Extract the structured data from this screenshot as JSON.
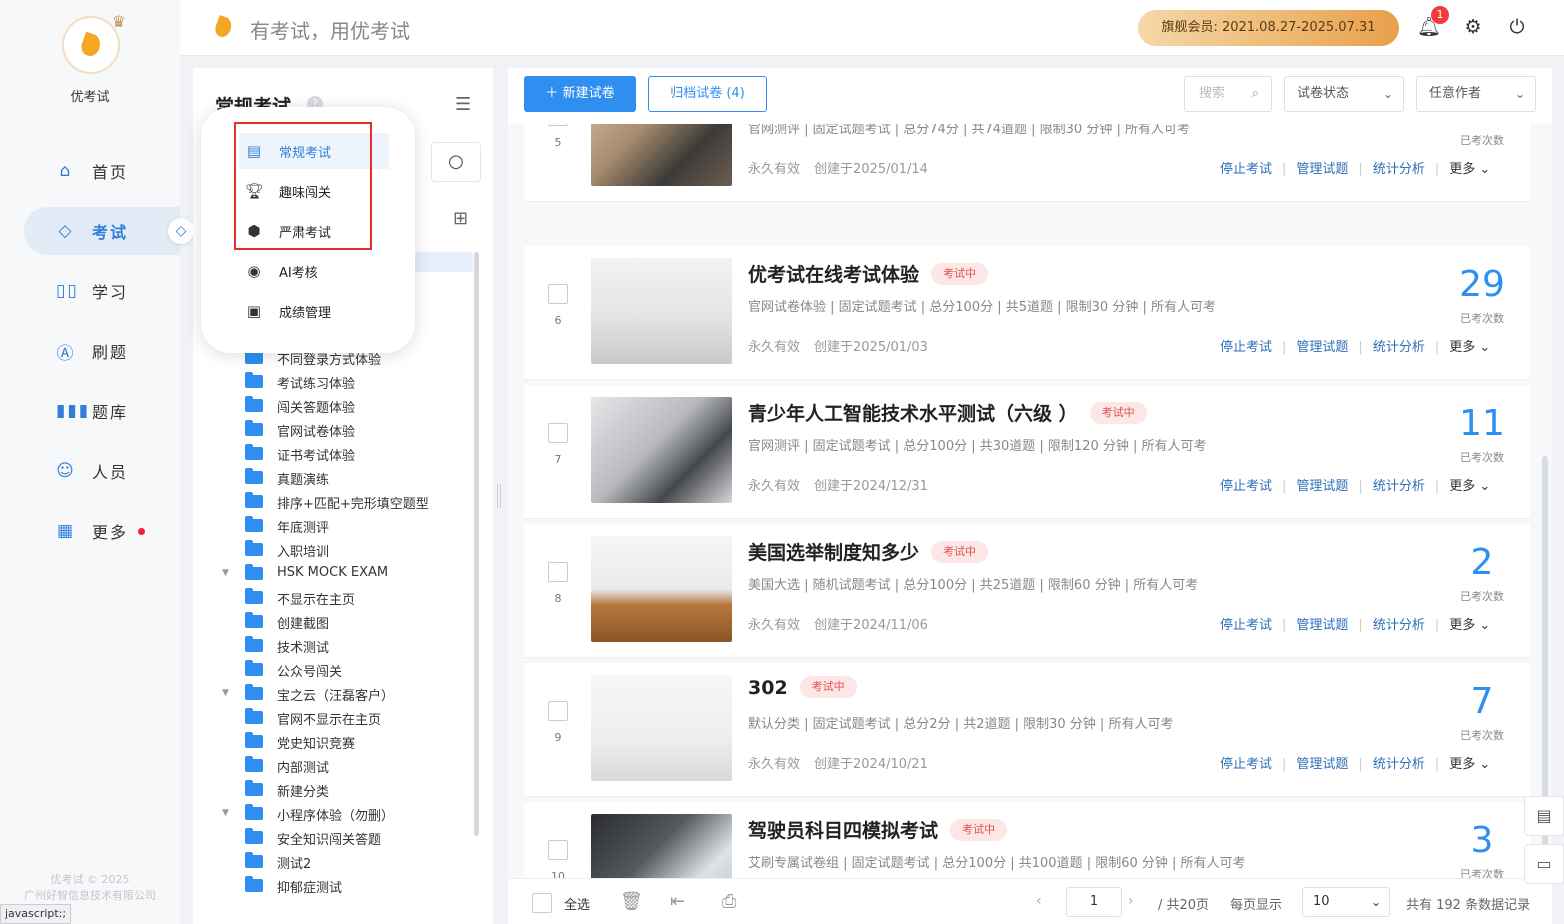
{
  "app": {
    "name": "优考试",
    "slogan": "有考试，用优考试"
  },
  "header": {
    "member_label": "旗舰会员: 2021.08.27-2025.07.31",
    "notification_count": "1"
  },
  "nav": {
    "items": [
      {
        "label": "首页",
        "icon": "home-icon"
      },
      {
        "label": "考试",
        "icon": "exam-icon"
      },
      {
        "label": "学习",
        "icon": "book-icon"
      },
      {
        "label": "刷题",
        "icon": "practice-icon"
      },
      {
        "label": "题库",
        "icon": "question-bank-icon"
      },
      {
        "label": "人员",
        "icon": "user-icon"
      },
      {
        "label": "更多",
        "icon": "more-icon"
      }
    ],
    "copyright": "优考试 © 2025",
    "company": "广州好智信息技术有限公司",
    "status_url": "javascript:;"
  },
  "folder_panel": {
    "title": "常规考试",
    "help": "?",
    "popup": [
      {
        "label": "常规考试",
        "icon": "document-icon"
      },
      {
        "label": "趣味闯关",
        "icon": "trophy-icon"
      },
      {
        "label": "严肃考试",
        "icon": "shield-icon"
      },
      {
        "label": "AI考核",
        "icon": "ai-icon"
      },
      {
        "label": "成绩管理",
        "icon": "report-icon"
      }
    ],
    "tree": [
      {
        "label": "不同登录方式体验",
        "arrow": false
      },
      {
        "label": "考试练习体验",
        "arrow": false
      },
      {
        "label": "闯关答题体验",
        "arrow": false
      },
      {
        "label": "官网试卷体验",
        "arrow": false
      },
      {
        "label": "证书考试体验",
        "arrow": false
      },
      {
        "label": "真题演练",
        "arrow": false
      },
      {
        "label": "排序+匹配+完形填空题型",
        "arrow": false
      },
      {
        "label": "年底测评",
        "arrow": false
      },
      {
        "label": "入职培训",
        "arrow": false
      },
      {
        "label": "HSK MOCK EXAM",
        "arrow": true
      },
      {
        "label": "不显示在主页",
        "arrow": false
      },
      {
        "label": "创建截图",
        "arrow": false
      },
      {
        "label": "技术测试",
        "arrow": false
      },
      {
        "label": "公众号闯关",
        "arrow": false
      },
      {
        "label": "宝之云（汪磊客户）",
        "arrow": true
      },
      {
        "label": "官网不显示在主页",
        "arrow": false
      },
      {
        "label": "党史知识竞赛",
        "arrow": false
      },
      {
        "label": "内部测试",
        "arrow": false
      },
      {
        "label": "新建分类",
        "arrow": false
      },
      {
        "label": "小程序体验（勿删）",
        "arrow": true
      },
      {
        "label": "安全知识闯关答题",
        "arrow": false
      },
      {
        "label": "测试2",
        "arrow": false
      },
      {
        "label": "抑郁症测试",
        "arrow": false
      }
    ]
  },
  "toolbar": {
    "new_label": "新建试卷",
    "archive_label": "归档试卷 (4)",
    "search_placeholder": "搜索",
    "status_select": "试卷状态",
    "author_select": "任意作者"
  },
  "cards": [
    {
      "index": "5",
      "title": "",
      "tag": "",
      "meta": "官网测评 | 固定试题考试 | 总分74分 | 共74道题 | 限制30 分钟 | 所有人可考",
      "validity": "永久有效",
      "created": "创建于2025/01/14",
      "count": "",
      "count_label": "已考次数"
    },
    {
      "index": "6",
      "title": "优考试在线考试体验",
      "tag": "考试中",
      "meta": "官网试卷体验 | 固定试题考试 | 总分100分 | 共5道题 | 限制30 分钟 | 所有人可考",
      "validity": "永久有效",
      "created": "创建于2025/01/03",
      "count": "29",
      "count_label": "已考次数"
    },
    {
      "index": "7",
      "title": "青少年人工智能技术水平测试（六级 ）",
      "tag": "考试中",
      "meta": "官网测评 | 固定试题考试 | 总分100分 | 共30道题 | 限制120 分钟 | 所有人可考",
      "validity": "永久有效",
      "created": "创建于2024/12/31",
      "count": "11",
      "count_label": "已考次数"
    },
    {
      "index": "8",
      "title": "美国选举制度知多少",
      "tag": "考试中",
      "meta": "美国大选 | 随机试题考试 | 总分100分 | 共25道题 | 限制60 分钟 | 所有人可考",
      "validity": "永久有效",
      "created": "创建于2024/11/06",
      "count": "2",
      "count_label": "已考次数"
    },
    {
      "index": "9",
      "title": "302",
      "tag": "考试中",
      "meta": "默认分类 | 固定试题考试 | 总分2分 | 共2道题 | 限制30 分钟 | 所有人可考",
      "validity": "永久有效",
      "created": "创建于2024/10/21",
      "count": "7",
      "count_label": "已考次数"
    },
    {
      "index": "10",
      "title": "驾驶员科目四模拟考试",
      "tag": "考试中",
      "meta": "艾刷专属试卷组 | 固定试题考试 | 总分100分 | 共100道题 | 限制60 分钟 | 所有人可考",
      "validity": "",
      "created": "",
      "count": "3",
      "count_label": "已考次数"
    }
  ],
  "card_actions": {
    "stop": "停止考试",
    "manage": "管理试题",
    "stats": "统计分析",
    "more": "更多"
  },
  "footer": {
    "select_all": "全选",
    "page": "1",
    "total_pages": "/ 共20页",
    "per_page_label": "每页显示",
    "per_page": "10",
    "total_records": "共有 192 条数据记录"
  }
}
